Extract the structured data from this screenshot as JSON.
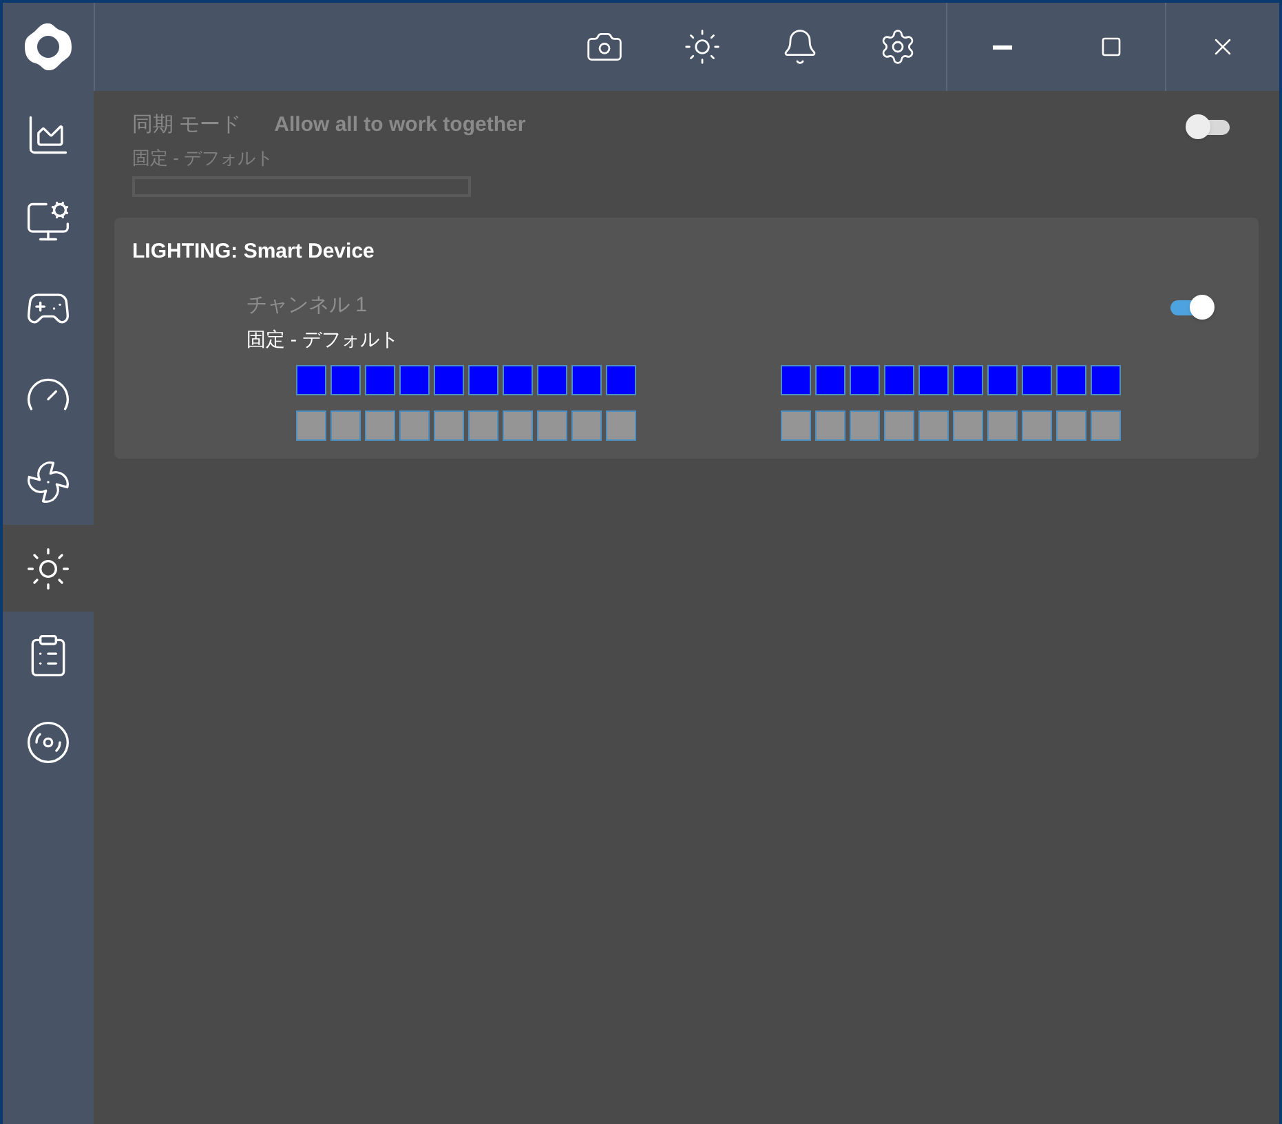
{
  "toolbar": {
    "items": [
      {
        "kind": "camera"
      },
      {
        "kind": "brightness"
      },
      {
        "kind": "bell"
      },
      {
        "kind": "settings"
      }
    ]
  },
  "sidebar": {
    "items": [
      {
        "kind": "dashboard",
        "selected": false
      },
      {
        "kind": "monitor",
        "selected": false
      },
      {
        "kind": "gamepad",
        "selected": false
      },
      {
        "kind": "gauge",
        "selected": false
      },
      {
        "kind": "fan",
        "selected": false
      },
      {
        "kind": "lighting",
        "selected": true
      },
      {
        "kind": "checklist",
        "selected": false
      },
      {
        "kind": "drive",
        "selected": false
      }
    ]
  },
  "sync": {
    "label": "同期 モード",
    "description": "Allow all to work together",
    "mode": "固定 - デフォルト",
    "on": false,
    "disabled": true,
    "level": 0
  },
  "lighting": {
    "title": "LIGHTING: Smart Device",
    "channel": "チャンネル 1",
    "mode": "固定 - デフォルト",
    "on": true,
    "led_groups": [
      {
        "rows": [
          {
            "leds": [
              {
                "color": "#0000ff"
              },
              {
                "color": "#0000ff"
              },
              {
                "color": "#0000ff"
              },
              {
                "color": "#0000ff"
              },
              {
                "color": "#0000ff"
              },
              {
                "color": "#0000ff"
              },
              {
                "color": "#0000ff"
              },
              {
                "color": "#0000ff"
              },
              {
                "color": "#0000ff"
              },
              {
                "color": "#0000ff"
              }
            ]
          },
          {
            "leds": [
              {
                "color": "#959595"
              },
              {
                "color": "#959595"
              },
              {
                "color": "#959595"
              },
              {
                "color": "#959595"
              },
              {
                "color": "#959595"
              },
              {
                "color": "#959595"
              },
              {
                "color": "#959595"
              },
              {
                "color": "#959595"
              },
              {
                "color": "#959595"
              },
              {
                "color": "#959595"
              }
            ]
          }
        ]
      },
      {
        "rows": [
          {
            "leds": [
              {
                "color": "#0000ff"
              },
              {
                "color": "#0000ff"
              },
              {
                "color": "#0000ff"
              },
              {
                "color": "#0000ff"
              },
              {
                "color": "#0000ff"
              },
              {
                "color": "#0000ff"
              },
              {
                "color": "#0000ff"
              },
              {
                "color": "#0000ff"
              },
              {
                "color": "#0000ff"
              },
              {
                "color": "#0000ff"
              }
            ]
          },
          {
            "leds": [
              {
                "color": "#959595"
              },
              {
                "color": "#959595"
              },
              {
                "color": "#959595"
              },
              {
                "color": "#959595"
              },
              {
                "color": "#959595"
              },
              {
                "color": "#959595"
              },
              {
                "color": "#959595"
              },
              {
                "color": "#959595"
              },
              {
                "color": "#959595"
              },
              {
                "color": "#959595"
              }
            ]
          }
        ]
      }
    ]
  }
}
